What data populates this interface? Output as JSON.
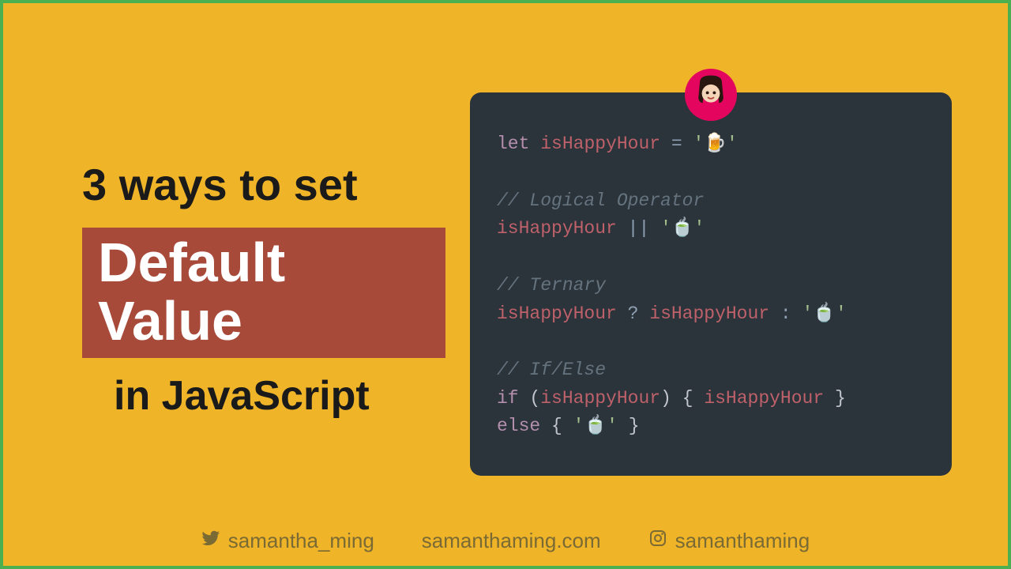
{
  "title": {
    "line1": "3 ways to set",
    "highlight": "Default Value",
    "line2": "in JavaScript"
  },
  "code": {
    "declaration": {
      "kw": "let",
      "var": "isHappyHour",
      "op": "=",
      "value_emoji": "🍺"
    },
    "section1": {
      "comment": "// Logical Operator",
      "var": "isHappyHour",
      "op": "||",
      "value_emoji": "🍵"
    },
    "section2": {
      "comment": "// Ternary",
      "var1": "isHappyHour",
      "q": "?",
      "var2": "isHappyHour",
      "c": ":",
      "value_emoji": "🍵"
    },
    "section3": {
      "comment": "// If/Else",
      "if_kw": "if",
      "var_cond": "isHappyHour",
      "var_body": "isHappyHour",
      "else_kw": "else",
      "value_emoji": "🍵"
    }
  },
  "footer": {
    "twitter": "samantha_ming",
    "website": "samanthaming.com",
    "instagram": "samanthaming"
  }
}
